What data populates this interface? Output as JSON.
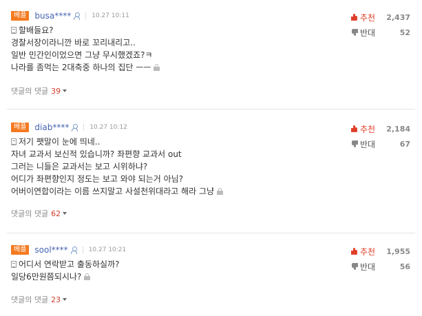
{
  "comments": [
    {
      "badge": "베플",
      "user": "busa****",
      "date": "10.27 10:11",
      "lines": [
        "할배들요?",
        "경찰서장이라니깐 바로 꼬리내리고..",
        "일반 민간인이었으면 그냥 무시했겠죠?ㅋ",
        "나라를 좀먹는 2대축중 하나의 집단 ㅡㅡ"
      ],
      "replies_label": "댓글의 댓글",
      "replies_count": "39",
      "up_label": "추천",
      "up_count": "2,437",
      "down_label": "반대",
      "down_count": "52"
    },
    {
      "badge": "베플",
      "user": "diab****",
      "date": "10.27 10:12",
      "lines": [
        "저기 팻말이 눈에 띄네..",
        "자녀 교과서 보신적 있습니까? 좌편향 교과서 out",
        "그러는 니들은 교과서는 보고 시위하냐?",
        "어디가 좌편향인지 정도는 보고 와야 되는거 아님?",
        "어버이연합이라는 이름 쓰지말고 사설천위대라고 해라 그냥"
      ],
      "replies_label": "댓글의 댓글",
      "replies_count": "62",
      "up_label": "추천",
      "up_count": "2,184",
      "down_label": "반대",
      "down_count": "67"
    },
    {
      "badge": "베플",
      "user": "sool****",
      "date": "10.27 10:21",
      "lines": [
        "어디서 연락받고 출동하실까?",
        "일당6만원쯤되시나?"
      ],
      "replies_label": "댓글의 댓글",
      "replies_count": "23",
      "up_label": "추천",
      "up_count": "1,955",
      "down_label": "반대",
      "down_count": "56"
    }
  ]
}
